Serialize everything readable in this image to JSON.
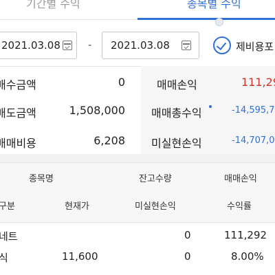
{
  "tabs": [
    {
      "label": "기간별 수익",
      "active": false
    },
    {
      "label": "종목별 수익",
      "active": true
    }
  ],
  "date_range": {
    "start": "2021.03.08",
    "separator": "-",
    "end": "2021.03.08"
  },
  "expense_checkbox": {
    "label": "제비용포",
    "checked": true
  },
  "summary": [
    {
      "label": "매수금액",
      "value": "0"
    },
    {
      "label": "매도금액",
      "value": "1,508,000"
    },
    {
      "label": "매매비용",
      "value": "6,208"
    },
    {
      "label": "매매손익",
      "value": "111,29"
    },
    {
      "label": "매매총수익",
      "value": "-14,595,7"
    },
    {
      "label": "미실현손익",
      "value": "-14,707,0"
    }
  ],
  "table": {
    "header_row1": [
      "종목명",
      "잔고수량",
      "매매손익"
    ],
    "header_row2": [
      "구분",
      "현재가",
      "미실현손익",
      "수익률"
    ],
    "rows": [
      {
        "name": "네트",
        "col2": "",
        "qty": "0",
        "pnl": "111,292"
      },
      {
        "name": "식",
        "col2": "11,600",
        "qty": "0",
        "pnl": "8.00%"
      }
    ]
  },
  "colors": {
    "accent": "#2f6fd6",
    "profit": "#d0342c",
    "loss": "#2f6fd6"
  },
  "icons": [
    "calendar-icon",
    "check-circle-icon"
  ]
}
